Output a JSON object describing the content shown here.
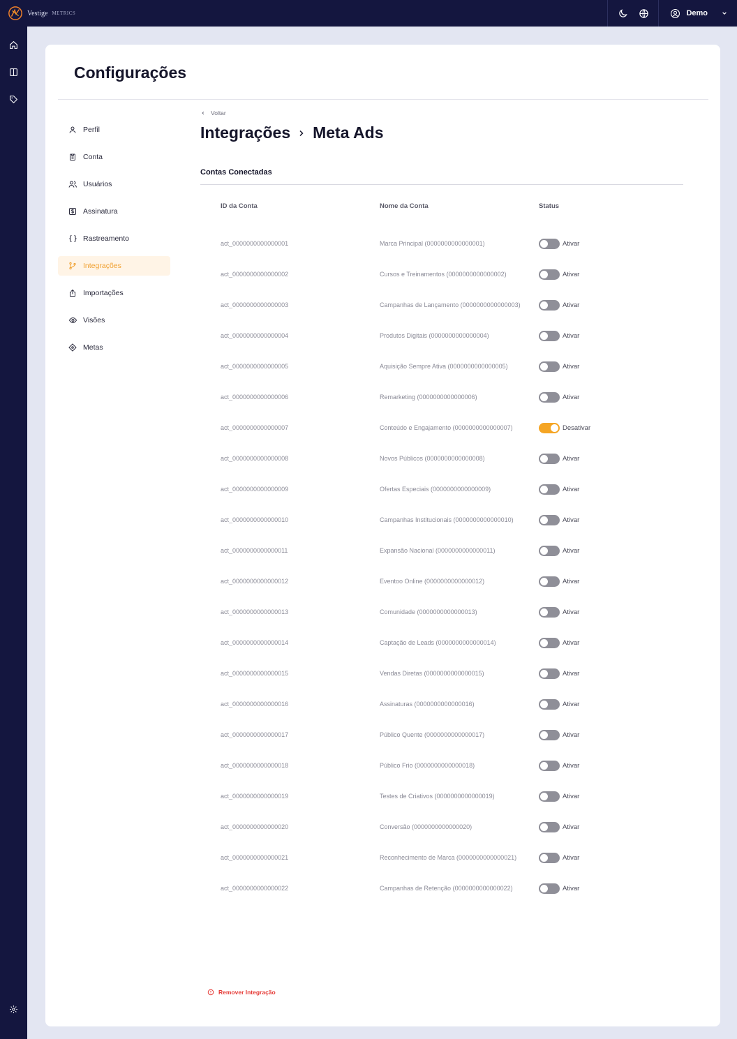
{
  "app": {
    "brand_name": "Vestige",
    "brand_sub": "METRICS",
    "user_name": "Demo"
  },
  "page": {
    "title": "Configurações"
  },
  "settings_nav": [
    {
      "label": "Perfil",
      "icon": "user-icon",
      "active": false
    },
    {
      "label": "Conta",
      "icon": "clipboard-icon",
      "active": false
    },
    {
      "label": "Usuários",
      "icon": "users-icon",
      "active": false
    },
    {
      "label": "Assinatura",
      "icon": "dollar-icon",
      "active": false
    },
    {
      "label": "Rastreamento",
      "icon": "braces-icon",
      "active": false
    },
    {
      "label": "Integrações",
      "icon": "git-branch-icon",
      "active": true
    },
    {
      "label": "Importações",
      "icon": "upload-icon",
      "active": false
    },
    {
      "label": "Visões",
      "icon": "eye-icon",
      "active": false
    },
    {
      "label": "Metas",
      "icon": "target-icon",
      "active": false
    }
  ],
  "main": {
    "back_label": "Voltar",
    "breadcrumb": [
      "Integrações",
      "Meta Ads"
    ],
    "section_title": "Contas Conectadas",
    "columns": [
      "ID da Conta",
      "Nome da Conta",
      "Status"
    ],
    "rows": [
      {
        "id": "act_0000000000000001",
        "name": "Marca Principal (0000000000000001)",
        "enabled": false,
        "status": "Ativar"
      },
      {
        "id": "act_0000000000000002",
        "name": "Cursos e Treinamentos (0000000000000002)",
        "enabled": false,
        "status": "Ativar"
      },
      {
        "id": "act_0000000000000003",
        "name": "Campanhas de Lançamento (0000000000000003)",
        "enabled": false,
        "status": "Ativar"
      },
      {
        "id": "act_0000000000000004",
        "name": "Produtos Digitais (0000000000000004)",
        "enabled": false,
        "status": "Ativar"
      },
      {
        "id": "act_0000000000000005",
        "name": "Aquisição Sempre Ativa (0000000000000005)",
        "enabled": false,
        "status": "Ativar"
      },
      {
        "id": "act_0000000000000006",
        "name": "Remarketing (0000000000000006)",
        "enabled": false,
        "status": "Ativar"
      },
      {
        "id": "act_0000000000000007",
        "name": "Conteúdo e Engajamento (0000000000000007)",
        "enabled": true,
        "status": "Desativar"
      },
      {
        "id": "act_0000000000000008",
        "name": "Novos Públicos (0000000000000008)",
        "enabled": false,
        "status": "Ativar"
      },
      {
        "id": "act_0000000000000009",
        "name": "Ofertas Especiais (0000000000000009)",
        "enabled": false,
        "status": "Ativar"
      },
      {
        "id": "act_0000000000000010",
        "name": "Campanhas Institucionais (0000000000000010)",
        "enabled": false,
        "status": "Ativar"
      },
      {
        "id": "act_0000000000000011",
        "name": "Expansão Nacional (0000000000000011)",
        "enabled": false,
        "status": "Ativar"
      },
      {
        "id": "act_0000000000000012",
        "name": "Eventoo Online (0000000000000012)",
        "enabled": false,
        "status": "Ativar"
      },
      {
        "id": "act_0000000000000013",
        "name": "Comunidade (0000000000000013)",
        "enabled": false,
        "status": "Ativar"
      },
      {
        "id": "act_0000000000000014",
        "name": "Captação de Leads (0000000000000014)",
        "enabled": false,
        "status": "Ativar"
      },
      {
        "id": "act_0000000000000015",
        "name": "Vendas Diretas (0000000000000015)",
        "enabled": false,
        "status": "Ativar"
      },
      {
        "id": "act_0000000000000016",
        "name": "Assinaturas (0000000000000016)",
        "enabled": false,
        "status": "Ativar"
      },
      {
        "id": "act_0000000000000017",
        "name": "Público Quente (0000000000000017)",
        "enabled": false,
        "status": "Ativar"
      },
      {
        "id": "act_0000000000000018",
        "name": "Público Frio (0000000000000018)",
        "enabled": false,
        "status": "Ativar"
      },
      {
        "id": "act_0000000000000019",
        "name": "Testes de Criativos (0000000000000019)",
        "enabled": false,
        "status": "Ativar"
      },
      {
        "id": "act_0000000000000020",
        "name": "Conversão (0000000000000020)",
        "enabled": false,
        "status": "Ativar"
      },
      {
        "id": "act_0000000000000021",
        "name": "Reconhecimento de Marca (0000000000000021)",
        "enabled": false,
        "status": "Ativar"
      },
      {
        "id": "act_0000000000000022",
        "name": "Campanhas de Retenção (0000000000000022)",
        "enabled": false,
        "status": "Ativar"
      }
    ],
    "remove_label": "Remover Integração"
  },
  "colors": {
    "topbar": "#14163f",
    "accent": "#f5a524",
    "danger": "#e53935",
    "active_nav_bg": "#fff4e6"
  }
}
